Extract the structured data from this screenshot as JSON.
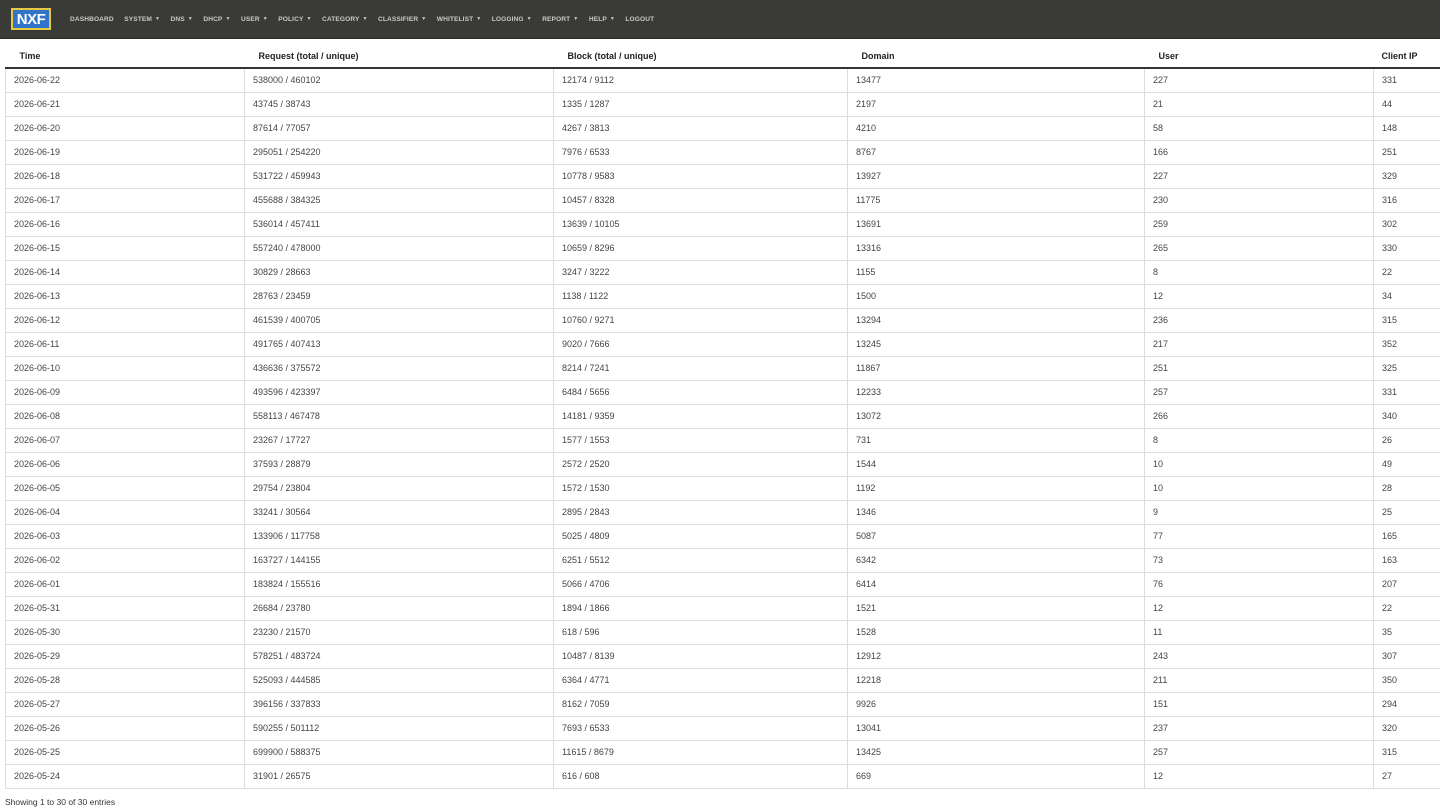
{
  "nav": {
    "logo": "NXF",
    "items": [
      {
        "label": "DASHBOARD",
        "dropdown": false
      },
      {
        "label": "SYSTEM",
        "dropdown": true
      },
      {
        "label": "DNS",
        "dropdown": true
      },
      {
        "label": "DHCP",
        "dropdown": true
      },
      {
        "label": "USER",
        "dropdown": true
      },
      {
        "label": "POLICY",
        "dropdown": true
      },
      {
        "label": "CATEGORY",
        "dropdown": true
      },
      {
        "label": "CLASSIFIER",
        "dropdown": true
      },
      {
        "label": "WHITELIST",
        "dropdown": true
      },
      {
        "label": "LOGGING",
        "dropdown": true
      },
      {
        "label": "REPORT",
        "dropdown": true
      },
      {
        "label": "HELP",
        "dropdown": true
      },
      {
        "label": "LOGOUT",
        "dropdown": false
      }
    ]
  },
  "table": {
    "columns": [
      "Time",
      "Request (total / unique)",
      "Block (total / unique)",
      "Domain",
      "User",
      "Client IP"
    ],
    "rows": [
      [
        "2026-06-22",
        "538000 / 460102",
        "12174 / 9112",
        "13477",
        "227",
        "331"
      ],
      [
        "2026-06-21",
        "43745 / 38743",
        "1335 / 1287",
        "2197",
        "21",
        "44"
      ],
      [
        "2026-06-20",
        "87614 / 77057",
        "4267 / 3813",
        "4210",
        "58",
        "148"
      ],
      [
        "2026-06-19",
        "295051 / 254220",
        "7976 / 6533",
        "8767",
        "166",
        "251"
      ],
      [
        "2026-06-18",
        "531722 / 459943",
        "10778 / 9583",
        "13927",
        "227",
        "329"
      ],
      [
        "2026-06-17",
        "455688 / 384325",
        "10457 / 8328",
        "11775",
        "230",
        "316"
      ],
      [
        "2026-06-16",
        "536014 / 457411",
        "13639 / 10105",
        "13691",
        "259",
        "302"
      ],
      [
        "2026-06-15",
        "557240 / 478000",
        "10659 / 8296",
        "13316",
        "265",
        "330"
      ],
      [
        "2026-06-14",
        "30829 / 28663",
        "3247 / 3222",
        "1155",
        "8",
        "22"
      ],
      [
        "2026-06-13",
        "28763 / 23459",
        "1138 / 1122",
        "1500",
        "12",
        "34"
      ],
      [
        "2026-06-12",
        "461539 / 400705",
        "10760 / 9271",
        "13294",
        "236",
        "315"
      ],
      [
        "2026-06-11",
        "491765 / 407413",
        "9020 / 7666",
        "13245",
        "217",
        "352"
      ],
      [
        "2026-06-10",
        "436636 / 375572",
        "8214 / 7241",
        "11867",
        "251",
        "325"
      ],
      [
        "2026-06-09",
        "493596 / 423397",
        "6484 / 5656",
        "12233",
        "257",
        "331"
      ],
      [
        "2026-06-08",
        "558113 / 467478",
        "14181 / 9359",
        "13072",
        "266",
        "340"
      ],
      [
        "2026-06-07",
        "23267 / 17727",
        "1577 / 1553",
        "731",
        "8",
        "26"
      ],
      [
        "2026-06-06",
        "37593 / 28879",
        "2572 / 2520",
        "1544",
        "10",
        "49"
      ],
      [
        "2026-06-05",
        "29754 / 23804",
        "1572 / 1530",
        "1192",
        "10",
        "28"
      ],
      [
        "2026-06-04",
        "33241 / 30564",
        "2895 / 2843",
        "1346",
        "9",
        "25"
      ],
      [
        "2026-06-03",
        "133906 / 117758",
        "5025 / 4809",
        "5087",
        "77",
        "165"
      ],
      [
        "2026-06-02",
        "163727 / 144155",
        "6251 / 5512",
        "6342",
        "73",
        "163"
      ],
      [
        "2026-06-01",
        "183824 / 155516",
        "5066 / 4706",
        "6414",
        "76",
        "207"
      ],
      [
        "2026-05-31",
        "26684 / 23780",
        "1894 / 1866",
        "1521",
        "12",
        "22"
      ],
      [
        "2026-05-30",
        "23230 / 21570",
        "618 / 596",
        "1528",
        "11",
        "35"
      ],
      [
        "2026-05-29",
        "578251 / 483724",
        "10487 / 8139",
        "12912",
        "243",
        "307"
      ],
      [
        "2026-05-28",
        "525093 / 444585",
        "6364 / 4771",
        "12218",
        "211",
        "350"
      ],
      [
        "2026-05-27",
        "396156 / 337833",
        "8162 / 7059",
        "9926",
        "151",
        "294"
      ],
      [
        "2026-05-26",
        "590255 / 501112",
        "7693 / 6533",
        "13041",
        "237",
        "320"
      ],
      [
        "2026-05-25",
        "699900 / 588375",
        "11615 / 8679",
        "13425",
        "257",
        "315"
      ],
      [
        "2026-05-24",
        "31901 / 26575",
        "616 / 608",
        "669",
        "12",
        "27"
      ]
    ]
  },
  "footer": {
    "info": "Showing 1 to 30 of 30 entries"
  }
}
